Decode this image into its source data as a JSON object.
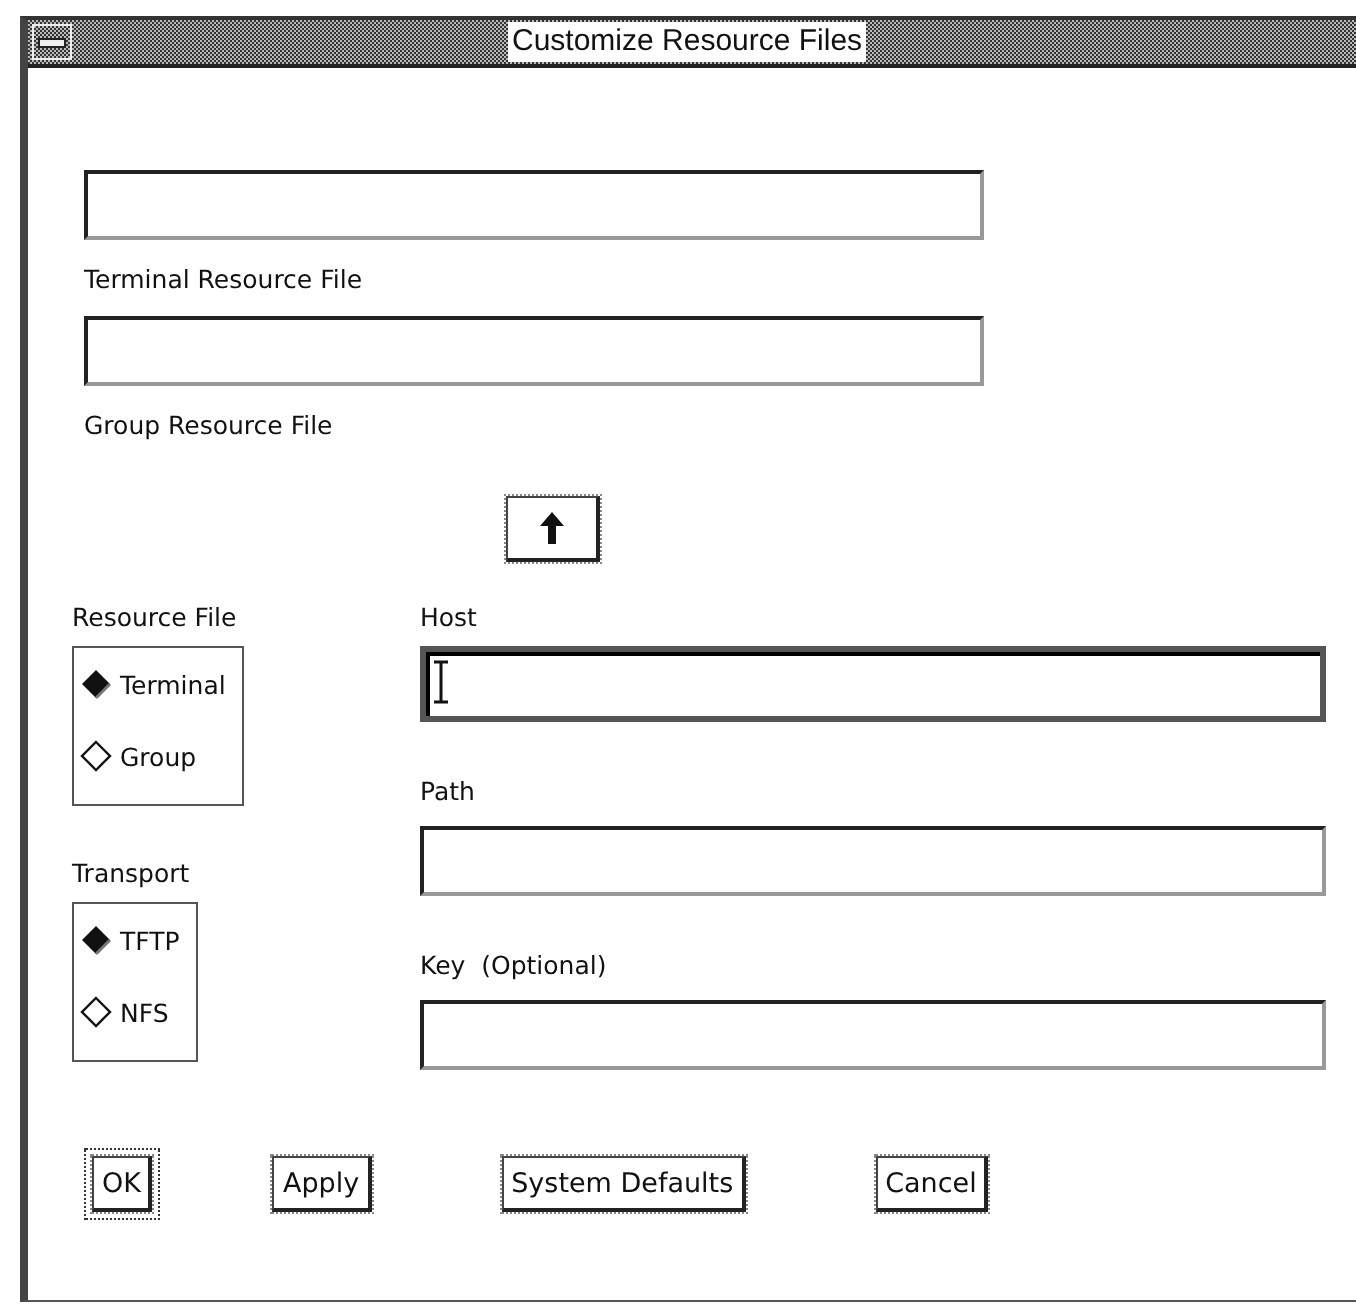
{
  "window": {
    "title": "Customize Resource Files"
  },
  "resource_files": [
    {
      "label": "Terminal Resource File"
    },
    {
      "label": "Group Resource File"
    }
  ],
  "radio_groups": [
    {
      "label": "Resource File",
      "options": [
        {
          "label": "Terminal",
          "selected": true
        },
        {
          "label": "Group",
          "selected": false
        }
      ]
    },
    {
      "label": "Transport",
      "options": [
        {
          "label": "TFTP",
          "selected": true
        },
        {
          "label": "NFS",
          "selected": false
        }
      ]
    }
  ],
  "fields": [
    {
      "label": "Host",
      "focused": true
    },
    {
      "label": "Path",
      "focused": false
    },
    {
      "label": "Key  (Optional)",
      "focused": false
    }
  ],
  "buttons": [
    {
      "label": "OK",
      "default": true
    },
    {
      "label": "Apply",
      "default": false
    },
    {
      "label": "System Defaults",
      "default": false
    },
    {
      "label": "Cancel",
      "default": false
    }
  ]
}
